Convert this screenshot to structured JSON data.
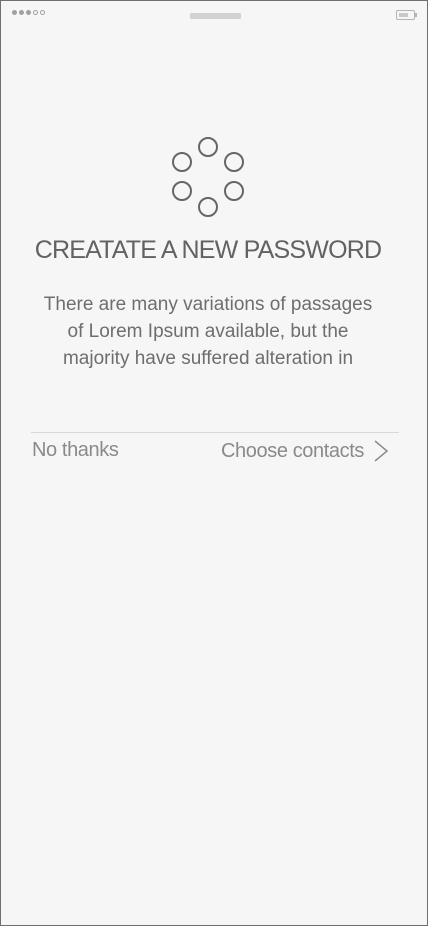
{
  "status_bar": {
    "signal_dots": [
      true,
      true,
      true,
      false,
      false
    ],
    "speaker": "speaker-grille",
    "battery_icon": "battery-icon"
  },
  "loader": {
    "icon": "loading-spinner-icon",
    "color": "#666666"
  },
  "title": "CREATATE A NEW PASSWORD",
  "description": "There are many variations of passages of Lorem Ipsum available, but the majority have suffered alteration in",
  "actions": {
    "no_thanks_label": "No thanks",
    "choose_contacts_label": "Choose contacts",
    "choose_contacts_icon": "chevron-right-icon"
  },
  "colors": {
    "background": "#f6f6f6",
    "frame": "#6f6f6f",
    "text": "#666666",
    "muted": "#8a8a8a",
    "divider": "#d9d9d9"
  }
}
